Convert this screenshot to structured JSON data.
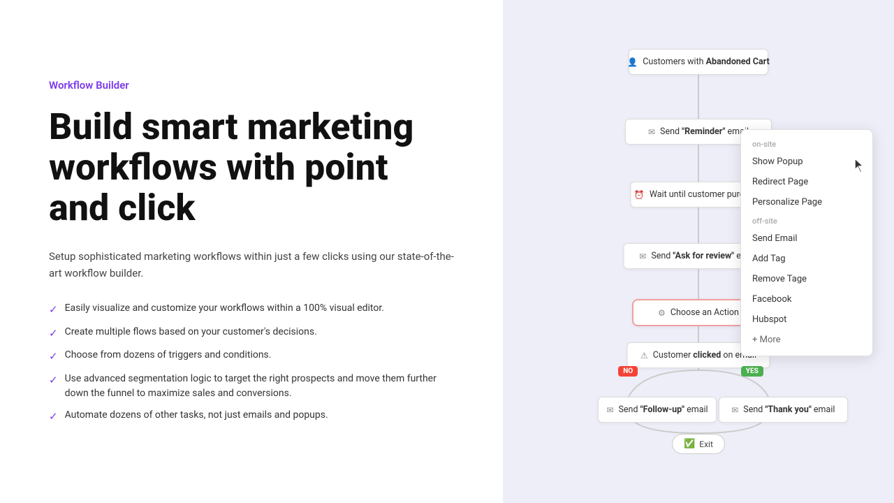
{
  "left": {
    "label": "Workflow Builder",
    "headline": "Build smart marketing workflows with point and click",
    "description": "Setup sophisticated marketing workflows within just a few clicks using our state-of-the-art workflow builder.",
    "features": [
      "Easily visualize and customize your workflows within a 100% visual editor.",
      "Create multiple flows based on your customer's decisions.",
      "Choose from dozens of triggers and conditions.",
      "Use advanced segmentation logic to target the right prospects and move them further down the funnel to maximize sales and conversions.",
      "Automate dozens of other tasks, not just emails and popups."
    ]
  },
  "workflow": {
    "trigger": "Customers with Abandoned Cart",
    "trigger_bold": "Abandoned Cart",
    "node1": "Send “Reminder” email",
    "node1_bold": "“Reminder”",
    "node2": "Wait until customer purchase",
    "node3": "Send “Ask for review” email",
    "node3_bold": "“Ask for review”",
    "action": "Choose an Action",
    "clicked": "Customer clicked on email",
    "clicked_bold": "clicked",
    "follow": "Send “Follow-up” email",
    "follow_bold": "“Follow-up”",
    "thankyou": "Send “Thank you” email",
    "thankyou_bold": "“Thank you”",
    "exit": "Exit",
    "badge_no": "NO",
    "badge_yes": "YES"
  },
  "dropdown": {
    "section_onsite": "on-site",
    "section_offsite": "off-site",
    "items_onsite": [
      "Show Popup",
      "Redirect Page",
      "Personalize Page"
    ],
    "items_offsite": [
      "Send Email",
      "Add Tag",
      "Remove Tage",
      "Facebook",
      "Hubspot"
    ],
    "more": "+ More"
  }
}
